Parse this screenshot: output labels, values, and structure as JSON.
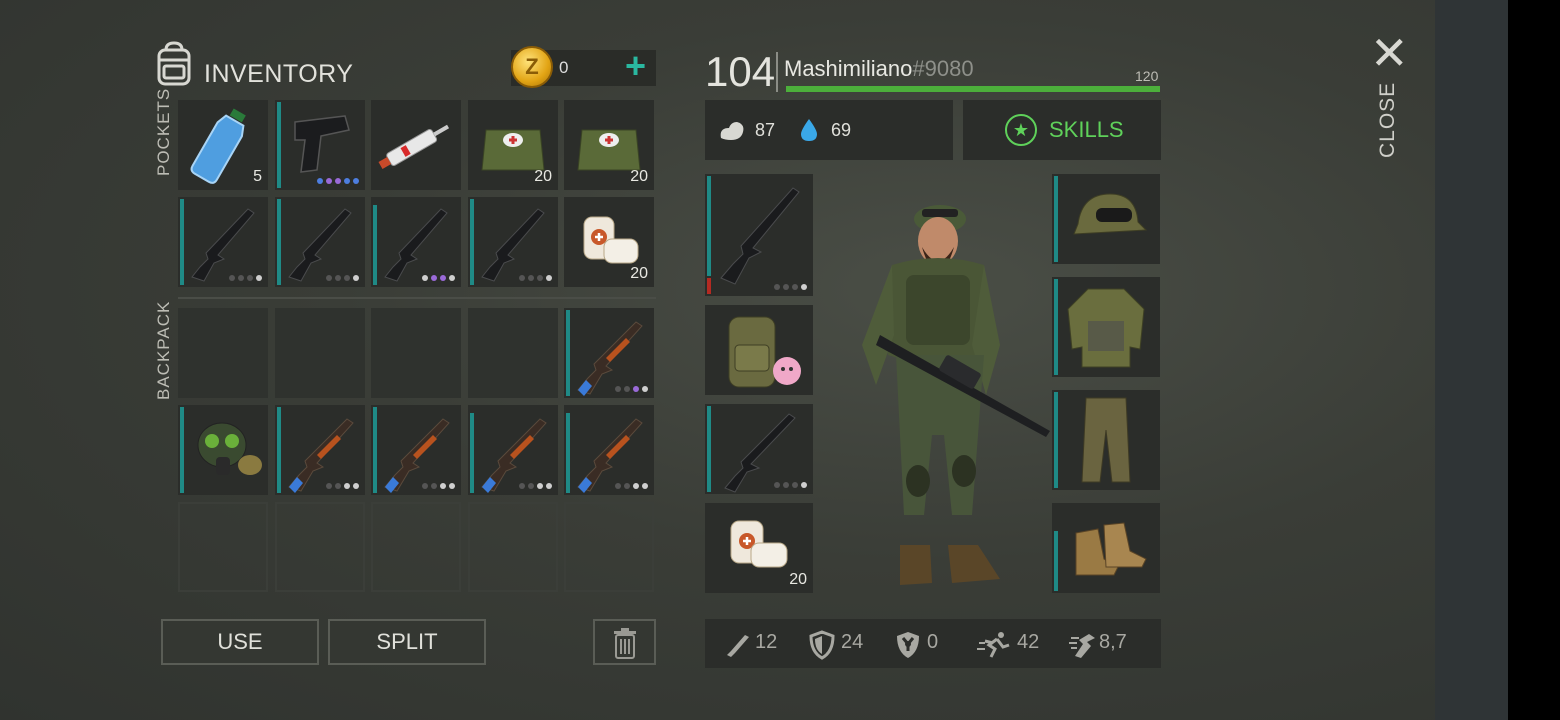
{
  "inventory": {
    "title": "INVENTORY",
    "coins": "0",
    "pockets_label": "POCKETS",
    "backpack_label": "BACKPACK"
  },
  "slots": {
    "water_count": "5",
    "medbag1_count": "20",
    "medbag2_count": "20",
    "bandage_count": "20"
  },
  "buttons": {
    "use": "USE",
    "split": "SPLIT"
  },
  "player": {
    "level": "104",
    "name": "Mashimiliano",
    "tag": "#9080",
    "hp_max": "120",
    "hp_fraction": 1.0,
    "hunger": "87",
    "thirst": "69",
    "skills_label": "SKILLS"
  },
  "equip": {
    "bandage_count": "20"
  },
  "stats": {
    "attack": "12",
    "armor": "24",
    "radiation": "0",
    "speed": "42",
    "weight": "8,7"
  },
  "close_label": "CLOSE",
  "colors": {
    "accent_teal": "#1f8a86",
    "skills_green": "#5fd15a",
    "hp_green": "#4caf3b",
    "coin_gold": "#e2a414"
  }
}
